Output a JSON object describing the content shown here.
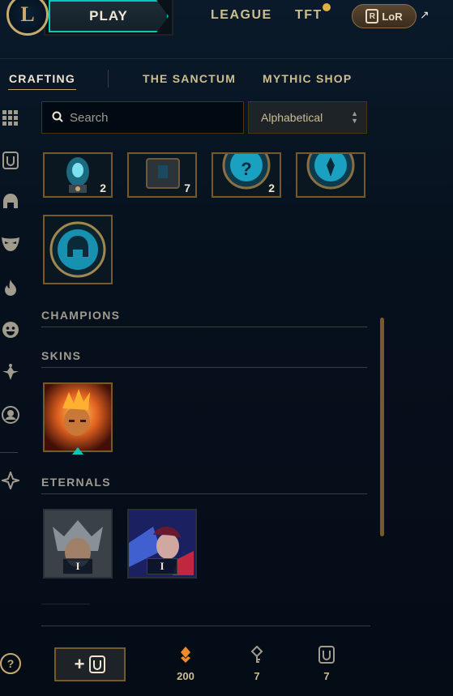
{
  "topbar": {
    "play_label": "PLAY",
    "nav": [
      "LEAGUE",
      "TFT"
    ],
    "lor_label": "LoR",
    "lor_badge": "R",
    "logo_letter": "L",
    "external_glyph": "↗"
  },
  "subnav": {
    "tabs": [
      "CRAFTING",
      "THE SANCTUM",
      "MYTHIC SHOP"
    ],
    "active": "CRAFTING"
  },
  "filters": {
    "search_placeholder": "Search",
    "sort_value": "Alphabetical"
  },
  "top_items": [
    {
      "icon": "emote-capsule-icon",
      "count": "2"
    },
    {
      "icon": "chest-icon",
      "count": "7"
    },
    {
      "icon": "mystery-orb-icon",
      "count": "2"
    },
    {
      "icon": "ward-orb-icon",
      "count": ""
    }
  ],
  "extra_item": {
    "icon": "helmet-token-icon"
  },
  "sections": {
    "champions": "CHAMPIONS",
    "skins": "SKINS",
    "eternals": "ETERNALS"
  },
  "eternals": [
    {
      "name": "eternal-1",
      "badge": "I"
    },
    {
      "name": "eternal-2",
      "badge": "I"
    }
  ],
  "footer": {
    "craft_plus": "+",
    "currencies": [
      {
        "icon": "orange-essence-icon",
        "value": "200"
      },
      {
        "icon": "key-fragment-icon",
        "value": "7"
      },
      {
        "icon": "token-icon",
        "value": "7"
      }
    ]
  },
  "help_label": "?",
  "colors": {
    "gold": "#c8aa6e",
    "teal": "#0ac8b9",
    "essence": "#f08a2c"
  }
}
